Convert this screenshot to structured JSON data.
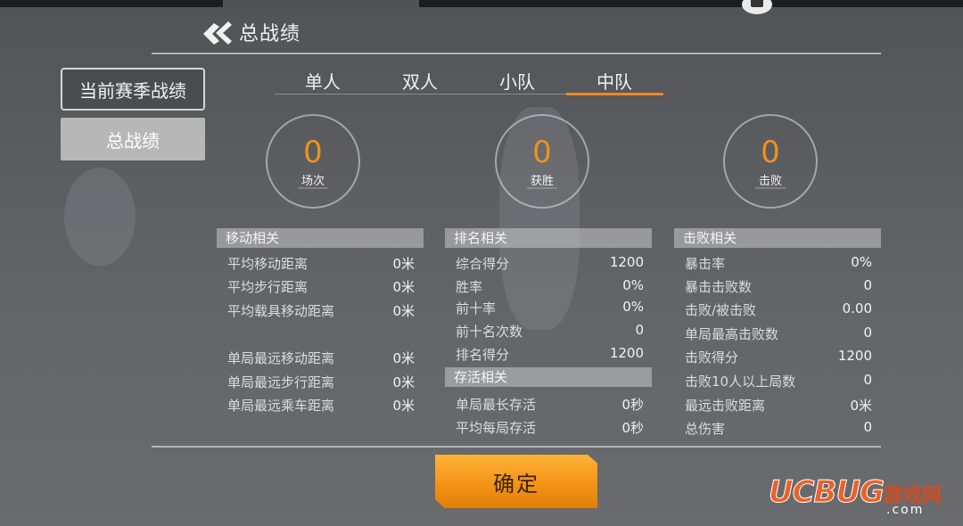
{
  "header": {
    "title": "总战绩"
  },
  "sidebar": {
    "items": [
      {
        "label": "当前赛季战绩",
        "active": false
      },
      {
        "label": "总战绩",
        "active": true
      }
    ]
  },
  "tabs": [
    {
      "label": "单人",
      "active": false
    },
    {
      "label": "双人",
      "active": false
    },
    {
      "label": "小队",
      "active": false
    },
    {
      "label": "中队",
      "active": true
    }
  ],
  "summary": [
    {
      "value": "0",
      "label": "场次"
    },
    {
      "value": "0",
      "label": "获胜"
    },
    {
      "value": "0",
      "label": "击败"
    }
  ],
  "sections": {
    "movement": {
      "title": "移动相关",
      "rows": [
        {
          "label": "平均移动距离",
          "value": "0米"
        },
        {
          "label": "平均步行距离",
          "value": "0米"
        },
        {
          "label": "平均载具移动距离",
          "value": "0米"
        },
        {
          "label": "单局最远移动距离",
          "value": "0米"
        },
        {
          "label": "单局最远步行距离",
          "value": "0米"
        },
        {
          "label": "单局最远乘车距离",
          "value": "0米"
        }
      ]
    },
    "ranking": {
      "title": "排名相关",
      "rows": [
        {
          "label": "综合得分",
          "value": "1200"
        },
        {
          "label": "胜率",
          "value": "0%"
        },
        {
          "label": "前十率",
          "value": "0%"
        },
        {
          "label": "前十名次数",
          "value": "0"
        },
        {
          "label": "排名得分",
          "value": "1200"
        }
      ]
    },
    "survival": {
      "title": "存活相关",
      "rows": [
        {
          "label": "单局最长存活",
          "value": "0秒"
        },
        {
          "label": "平均每局存活",
          "value": "0秒"
        }
      ]
    },
    "kills": {
      "title": "击败相关",
      "rows": [
        {
          "label": "暴击率",
          "value": "0%"
        },
        {
          "label": "暴击击败数",
          "value": "0"
        },
        {
          "label": "击败/被击败",
          "value": "0.00"
        },
        {
          "label": "单局最高击败数",
          "value": "0"
        },
        {
          "label": "击败得分",
          "value": "1200"
        },
        {
          "label": "击败10人以上局数",
          "value": "0"
        },
        {
          "label": "最远击败距离",
          "value": "0米"
        },
        {
          "label": "总伤害",
          "value": "0"
        }
      ]
    }
  },
  "footer": {
    "confirm_label": "确定"
  },
  "watermark": {
    "brand": "UCBUG",
    "cn": "游戏网",
    "domain": ".com"
  },
  "colors": {
    "accent": "#f08a1e",
    "button": "#f39415"
  },
  "icons": {
    "title": "wing-emblem-icon",
    "top_right": "camera-icon"
  }
}
